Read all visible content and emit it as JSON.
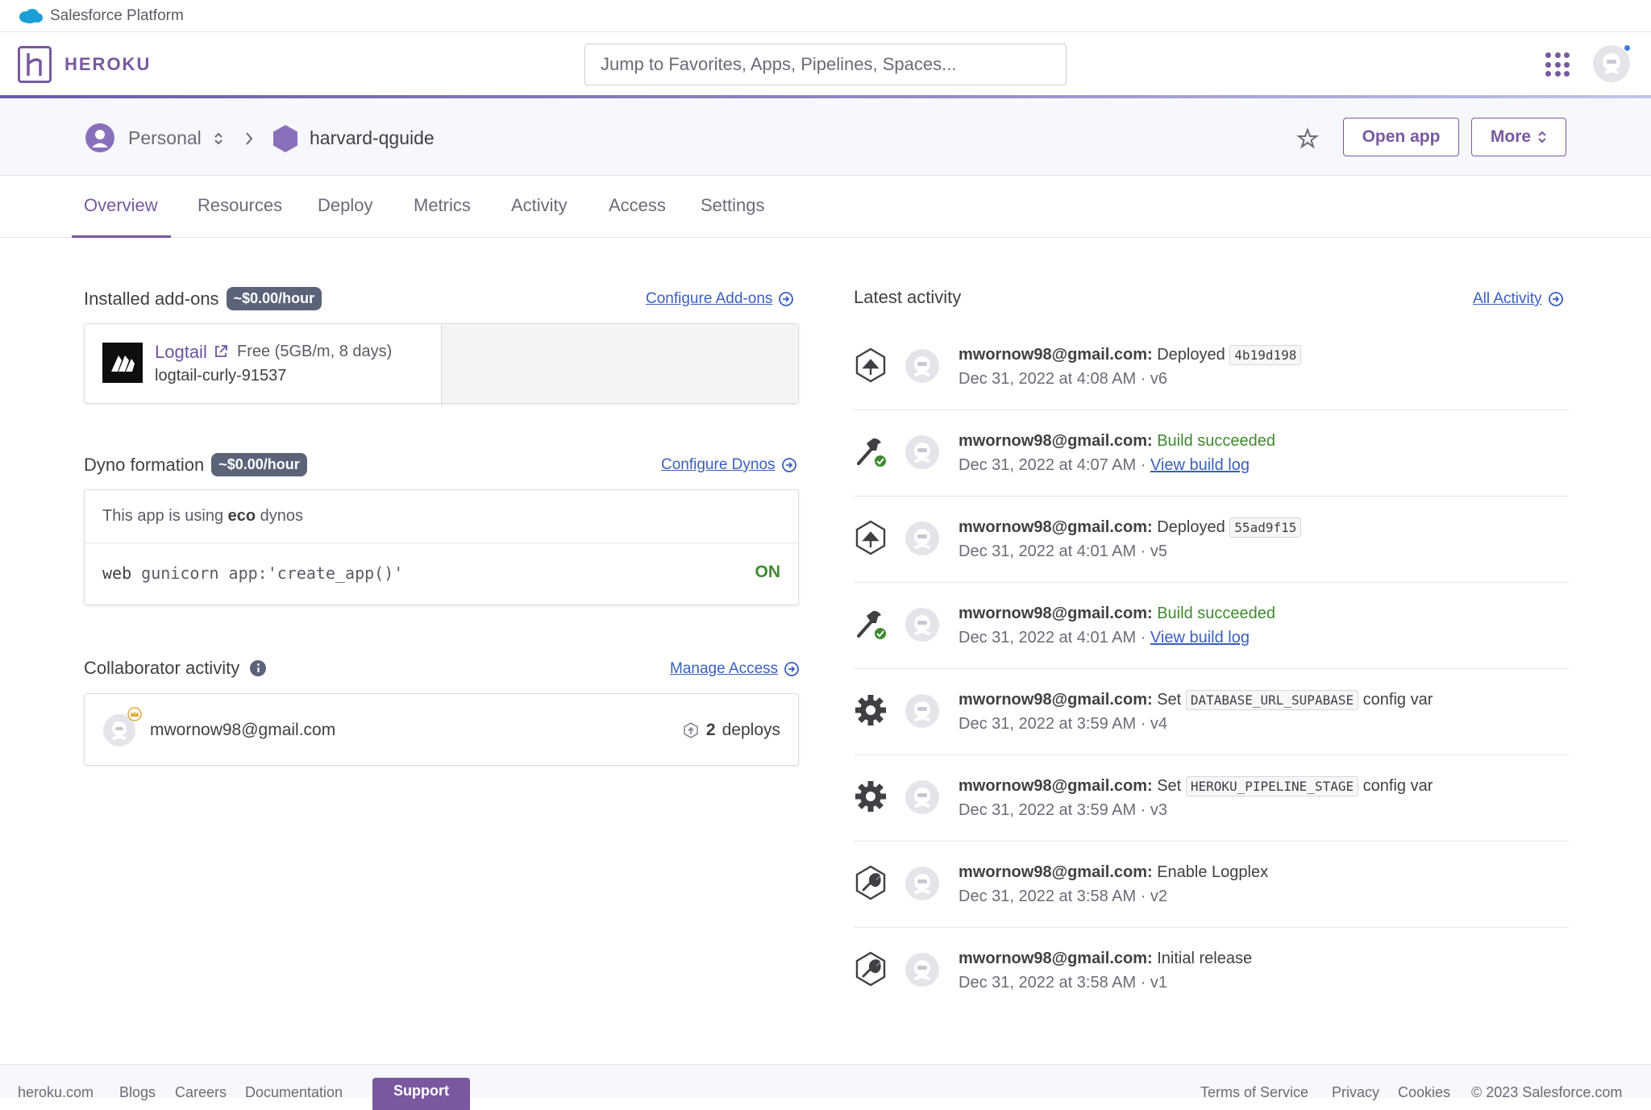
{
  "salesforce": {
    "label": "Salesforce Platform"
  },
  "topnav": {
    "brand": "HEROKU",
    "search_placeholder": "Jump to Favorites, Apps, Pipelines, Spaces..."
  },
  "app_header": {
    "account": "Personal",
    "app_name": "harvard-qguide",
    "open_app": "Open app",
    "more": "More"
  },
  "tabs": [
    "Overview",
    "Resources",
    "Deploy",
    "Metrics",
    "Activity",
    "Access",
    "Settings"
  ],
  "addons": {
    "title": "Installed add-ons",
    "cost": "~$0.00/hour",
    "configure": "Configure Add-ons",
    "items": [
      {
        "name": "Logtail",
        "plan": "Free (5GB/m, 8 days)",
        "id": "logtail-curly-91537"
      }
    ]
  },
  "dynos": {
    "title": "Dyno formation",
    "cost": "~$0.00/hour",
    "configure": "Configure Dynos",
    "note_prefix": "This app is using",
    "note_type": "eco",
    "note_suffix": "dynos",
    "process": {
      "type": "web",
      "command": "gunicorn app:'create_app()'",
      "state": "ON"
    }
  },
  "collaborators": {
    "title": "Collaborator activity",
    "manage": "Manage Access",
    "items": [
      {
        "email": "mwornow98@gmail.com",
        "deploys": "2",
        "deploys_label": "deploys"
      }
    ]
  },
  "activity": {
    "title": "Latest activity",
    "all": "All Activity",
    "items": [
      {
        "icon": "deploy-icon",
        "who": "mwornow98@gmail.com:",
        "action": "Deployed",
        "code": "4b19d198",
        "after": "",
        "time": "Dec 31, 2022 at 4:08 AM · v6",
        "link": ""
      },
      {
        "icon": "build-icon",
        "who": "mwornow98@gmail.com:",
        "action": "Build succeeded",
        "code": "",
        "after": "",
        "time": "Dec 31, 2022 at 4:07 AM · ",
        "link": "View build log"
      },
      {
        "icon": "deploy-icon",
        "who": "mwornow98@gmail.com:",
        "action": "Deployed",
        "code": "55ad9f15",
        "after": "",
        "time": "Dec 31, 2022 at 4:01 AM · v5",
        "link": ""
      },
      {
        "icon": "build-icon",
        "who": "mwornow98@gmail.com:",
        "action": "Build succeeded",
        "code": "",
        "after": "",
        "time": "Dec 31, 2022 at 4:01 AM · ",
        "link": "View build log"
      },
      {
        "icon": "gear-icon",
        "who": "mwornow98@gmail.com:",
        "action": "Set",
        "code": "DATABASE_URL_SUPABASE",
        "after": "config var",
        "time": "Dec 31, 2022 at 3:59 AM · v4",
        "link": ""
      },
      {
        "icon": "gear-icon",
        "who": "mwornow98@gmail.com:",
        "action": "Set",
        "code": "HEROKU_PIPELINE_STAGE",
        "after": "config var",
        "time": "Dec 31, 2022 at 3:59 AM · v3",
        "link": ""
      },
      {
        "icon": "wrench-icon",
        "who": "mwornow98@gmail.com:",
        "action": "Enable Logplex",
        "code": "",
        "after": "",
        "time": "Dec 31, 2022 at 3:58 AM · v2",
        "link": ""
      },
      {
        "icon": "wrench-icon",
        "who": "mwornow98@gmail.com:",
        "action": "Initial release",
        "code": "",
        "after": "",
        "time": "Dec 31, 2022 at 3:58 AM · v1",
        "link": ""
      }
    ]
  },
  "footer": {
    "links_left": [
      "heroku.com",
      "Blogs",
      "Careers",
      "Documentation"
    ],
    "support": "Support",
    "links_right": [
      "Terms of Service",
      "Privacy",
      "Cookies",
      "© 2023 Salesforce.com"
    ]
  },
  "colors": {
    "brand": "#79589f",
    "link": "#3b5fc0",
    "success": "#3f8a2f",
    "badge": "#5a6378"
  }
}
